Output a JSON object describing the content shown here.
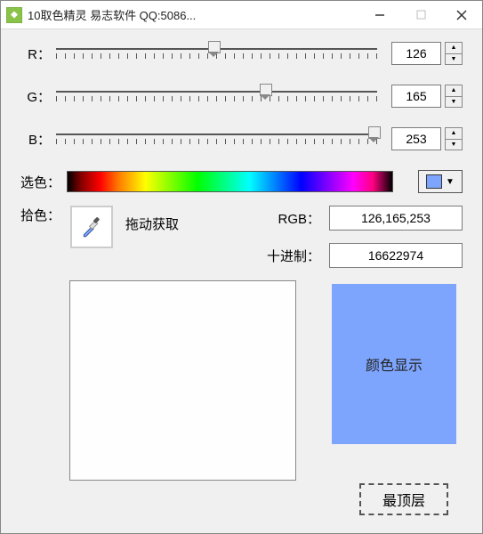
{
  "window": {
    "title": "10取色精灵 易志软件 QQ:5086..."
  },
  "sliders": {
    "r": {
      "label": "R：",
      "value": "126",
      "percent": 49
    },
    "g": {
      "label": "G：",
      "value": "165",
      "percent": 65
    },
    "b": {
      "label": "B：",
      "value": "253",
      "percent": 99
    }
  },
  "select_color": {
    "label": "选色："
  },
  "color_button": {
    "swatch": "#7ea5fd"
  },
  "pick": {
    "label": "拾色：",
    "drag_text": "拖动获取"
  },
  "values": {
    "rgb_label": "RGB：",
    "rgb_value": "126,165,253",
    "dec_label": "十进制：",
    "dec_value": "16622974"
  },
  "display": {
    "label": "颜色显示",
    "bg": "#7ea5fd"
  },
  "topmost": {
    "label": "最顶层"
  }
}
